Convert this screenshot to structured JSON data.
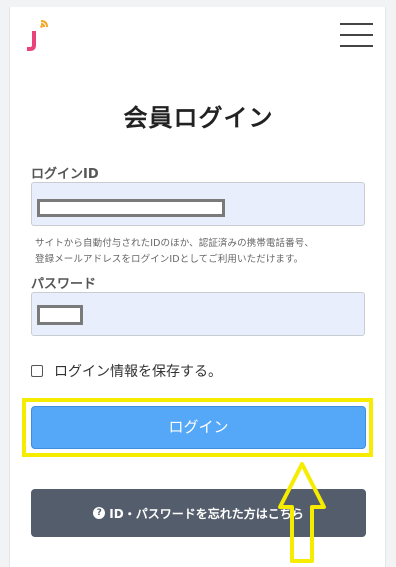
{
  "header": {
    "logo_icon": "j-logo-with-signal-icon",
    "menu_icon": "hamburger-menu-icon"
  },
  "page": {
    "title": "会員ログイン"
  },
  "form": {
    "login_id_label": "ログインID",
    "login_id_value": "",
    "hint_line1": "サイトから自動付与されたIDのほか、認証済みの携帯電話番号、",
    "hint_line2": "登録メールアドレスをログインIDとしてご利用いただけます。",
    "password_label": "パスワード",
    "password_value": "",
    "remember_label": "ログイン情報を保存する。",
    "remember_checked": false,
    "login_button": "ログイン",
    "forgot_button": "ID・パスワードを忘れた方はこちら",
    "forgot_icon": "question-circle-icon"
  },
  "colors": {
    "login_button": "#55a7f7",
    "forgot_button": "#545d6b",
    "highlight": "#f5ec00",
    "logo_pink": "#e8447a",
    "logo_orange": "#f5a623"
  }
}
